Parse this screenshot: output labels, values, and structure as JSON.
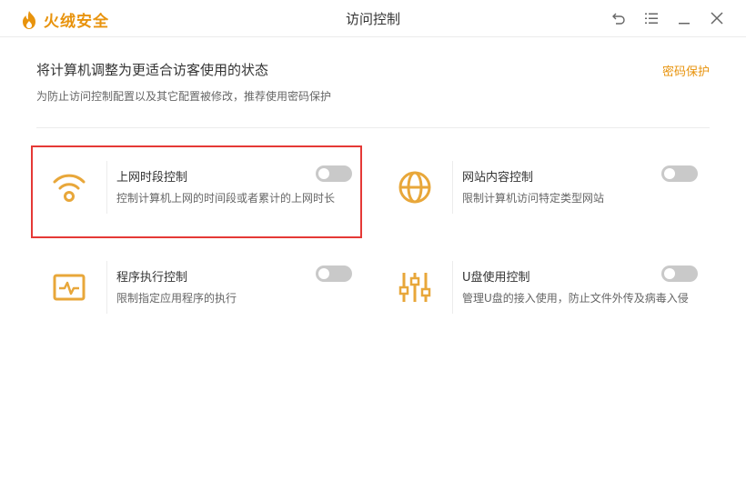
{
  "app": {
    "brand": "火绒安全",
    "title": "访问控制"
  },
  "colors": {
    "accent": "#e8930c",
    "highlight": "#e53936",
    "toggle_off": "#c9c9c9"
  },
  "window_controls": [
    {
      "icon": "back-arrow-icon"
    },
    {
      "icon": "menu-icon"
    },
    {
      "icon": "minimize-icon"
    },
    {
      "icon": "close-icon"
    }
  ],
  "header": {
    "title": "将计算机调整为更适合访客使用的状态",
    "subtitle": "为防止访问控制配置以及其它配置被修改，推荐使用密码保护",
    "password_link": "密码保护"
  },
  "controls": [
    {
      "icon": "wifi-icon",
      "title": "上网时段控制",
      "desc": "控制计算机上网的时间段或者累计的上网时长",
      "enabled": false,
      "highlighted": true
    },
    {
      "icon": "globe-icon",
      "title": "网站内容控制",
      "desc": "限制计算机访问特定类型网站",
      "enabled": false,
      "highlighted": false
    },
    {
      "icon": "monitor-pulse-icon",
      "title": "程序执行控制",
      "desc": "限制指定应用程序的执行",
      "enabled": false,
      "highlighted": false
    },
    {
      "icon": "sliders-icon",
      "title": "U盘使用控制",
      "desc": "管理U盘的接入使用，防止文件外传及病毒入侵",
      "enabled": false,
      "highlighted": false
    }
  ]
}
